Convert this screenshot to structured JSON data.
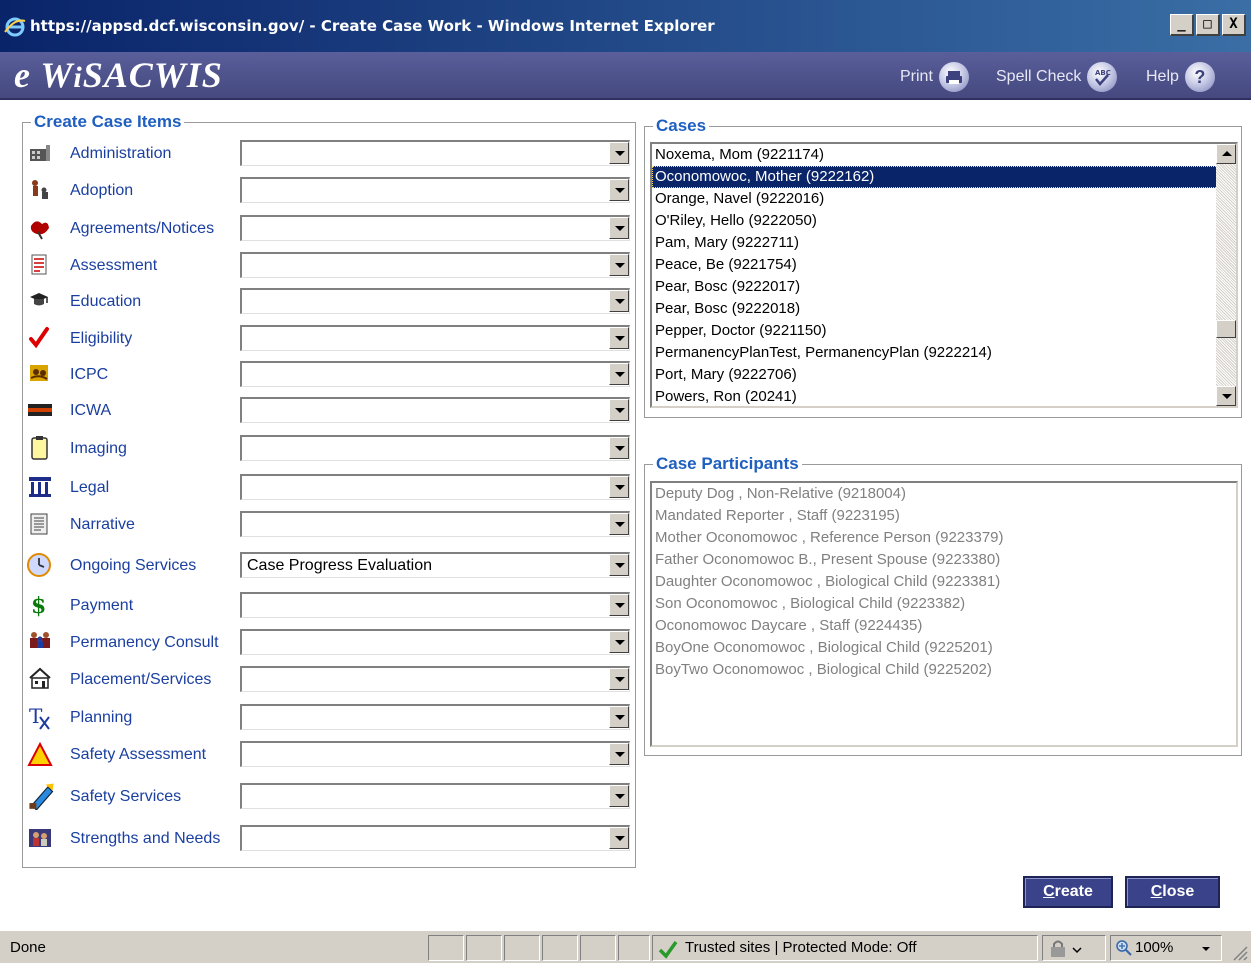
{
  "window": {
    "title": "https://appsd.dcf.wisconsin.gov/ - Create Case Work - Windows Internet Explorer",
    "min_label": "_",
    "max_label": "□",
    "close_label": "X"
  },
  "header": {
    "brand_e": "e ",
    "brand_w": "W",
    "brand_i": "i",
    "brand_rest_s": "S",
    "brand_a": "A",
    "brand_cwis": "CWIS",
    "print_label": "Print",
    "spell_label": "Spell Check",
    "help_label": "Help",
    "help_icon_glyph": "?"
  },
  "left_panel": {
    "title": "Create Case Items",
    "items": [
      {
        "label": "Administration",
        "icon": "administration-icon",
        "value": ""
      },
      {
        "label": "Adoption",
        "icon": "adoption-icon",
        "value": ""
      },
      {
        "label": "Agreements/Notices",
        "icon": "agreements-icon",
        "value": ""
      },
      {
        "label": "Assessment",
        "icon": "assessment-icon",
        "value": ""
      },
      {
        "label": "Education",
        "icon": "education-icon",
        "value": ""
      },
      {
        "label": "Eligibility",
        "icon": "eligibility-check-icon",
        "value": ""
      },
      {
        "label": "ICPC",
        "icon": "icpc-icon",
        "value": ""
      },
      {
        "label": "ICWA",
        "icon": "icwa-icon",
        "value": ""
      },
      {
        "label": "Imaging",
        "icon": "imaging-icon",
        "value": ""
      },
      {
        "label": "Legal",
        "icon": "legal-icon",
        "value": ""
      },
      {
        "label": "Narrative",
        "icon": "narrative-icon",
        "value": ""
      },
      {
        "label": "Ongoing Services",
        "icon": "clock-icon",
        "value": "Case Progress Evaluation"
      },
      {
        "label": "Payment",
        "icon": "dollar-icon",
        "value": ""
      },
      {
        "label": "Permanency Consult",
        "icon": "permanency-icon",
        "value": ""
      },
      {
        "label": "Placement/Services",
        "icon": "house-icon",
        "value": ""
      },
      {
        "label": "Planning",
        "icon": "planning-icon",
        "value": ""
      },
      {
        "label": "Safety Assessment",
        "icon": "warning-icon",
        "value": ""
      },
      {
        "label": "Safety Services",
        "icon": "safety-services-icon",
        "value": ""
      },
      {
        "label": "Strengths and Needs",
        "icon": "strengths-icon",
        "value": ""
      }
    ]
  },
  "cases": {
    "title": "Cases",
    "items": [
      "Noxema, Mom (9221174)",
      "Oconomowoc, Mother (9222162)",
      "Orange, Navel (9222016)",
      "O'Riley, Hello (9222050)",
      "Pam, Mary (9222711)",
      "Peace, Be (9221754)",
      "Pear, Bosc (9222017)",
      "Pear, Bosc (9222018)",
      "Pepper, Doctor (9221150)",
      "PermanencyPlanTest, PermanencyPlan (9222214)",
      "Port, Mary (9222706)",
      "Powers, Ron (20241)"
    ],
    "selected": "Oconomowoc, Mother (9222162)"
  },
  "participants": {
    "title": "Case Participants",
    "items": [
      "Deputy Dog , Non-Relative (9218004)",
      "Mandated Reporter , Staff (9223195)",
      "Mother Oconomowoc , Reference Person (9223379)",
      "Father Oconomowoc B., Present Spouse (9223380)",
      "Daughter Oconomowoc , Biological Child (9223381)",
      "Son Oconomowoc , Biological Child (9223382)",
      "Oconomowoc Daycare , Staff (9224435)",
      "BoyOne Oconomowoc , Biological Child (9225201)",
      "BoyTwo Oconomowoc , Biological Child (9225202)"
    ]
  },
  "buttons": {
    "create_accel": "C",
    "create_rest": "reate",
    "close_accel": "C",
    "close_rest": "lose"
  },
  "statusbar": {
    "status": "Done",
    "zone": "Trusted sites | Protected Mode: Off",
    "zoom": "100%"
  },
  "colors": {
    "title_bar": "#0a246a",
    "app_header": "#4f5390",
    "legend_text": "#1f5fc0",
    "label_text": "#1a3fa0",
    "selected_row": "#0a246a",
    "button_bg": "#3a4389"
  }
}
